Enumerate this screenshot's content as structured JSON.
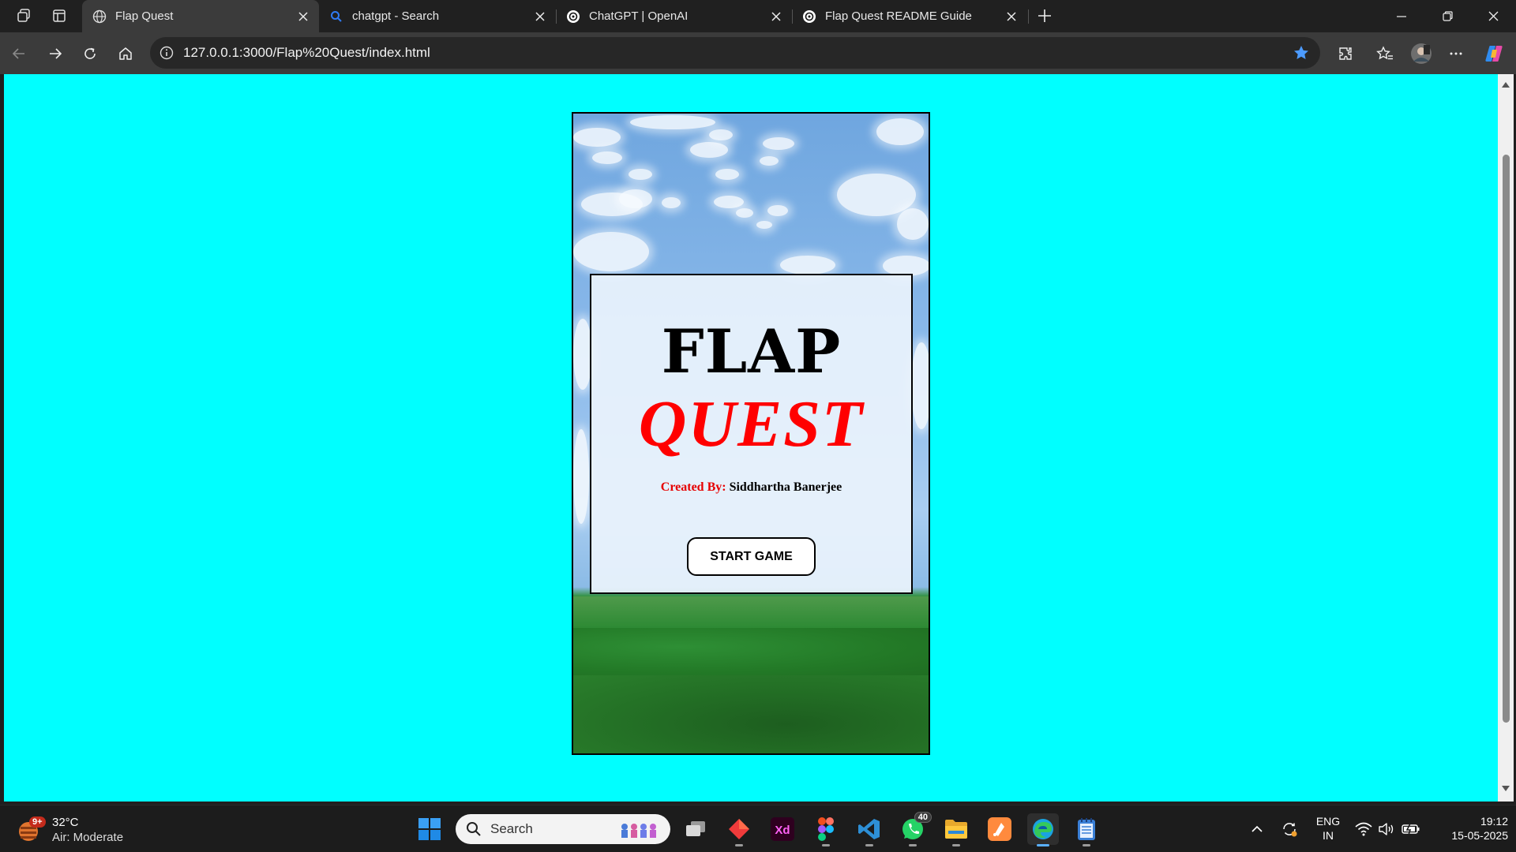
{
  "browser": {
    "tabs": [
      {
        "title": "Flap Quest",
        "icon": "globe-icon",
        "active": true
      },
      {
        "title": "chatgpt - Search",
        "icon": "search-icon",
        "active": false
      },
      {
        "title": "ChatGPT | OpenAI",
        "icon": "openai-icon",
        "active": false
      },
      {
        "title": "Flap Quest README Guide",
        "icon": "openai-icon",
        "active": false
      }
    ],
    "address_bar": {
      "url": "127.0.0.1:3000/Flap%20Quest/index.html"
    },
    "accent": "#4c9bff"
  },
  "page": {
    "background_color": "#00ffff",
    "game": {
      "title_line1": "FLAP",
      "title_line2": "QUEST",
      "title_line2_color": "#ff0000",
      "credits_label": "Created By:",
      "credits_name": "Siddhartha Banerjee",
      "start_button": "START GAME"
    }
  },
  "taskbar": {
    "weather": {
      "badge": "9+",
      "temperature": "32°C",
      "air_quality": "Air: Moderate"
    },
    "search_placeholder": "Search",
    "apps": [
      {
        "name": "task-view",
        "icon": "task-view-icon"
      },
      {
        "name": "app-red-diamond",
        "icon": "red-diamond-icon"
      },
      {
        "name": "adobe-xd",
        "icon": "adobe-xd-icon",
        "label": "Xd"
      },
      {
        "name": "figma",
        "icon": "figma-icon"
      },
      {
        "name": "vscode",
        "icon": "vscode-icon"
      },
      {
        "name": "whatsapp",
        "icon": "whatsapp-icon",
        "badge": "40"
      },
      {
        "name": "file-explorer",
        "icon": "folder-icon"
      },
      {
        "name": "app-orange",
        "icon": "orange-app-icon"
      },
      {
        "name": "edge",
        "icon": "edge-icon"
      },
      {
        "name": "notepad",
        "icon": "notepad-icon"
      }
    ],
    "language": {
      "line1": "ENG",
      "line2": "IN"
    },
    "time": "19:12",
    "date": "15-05-2025"
  }
}
